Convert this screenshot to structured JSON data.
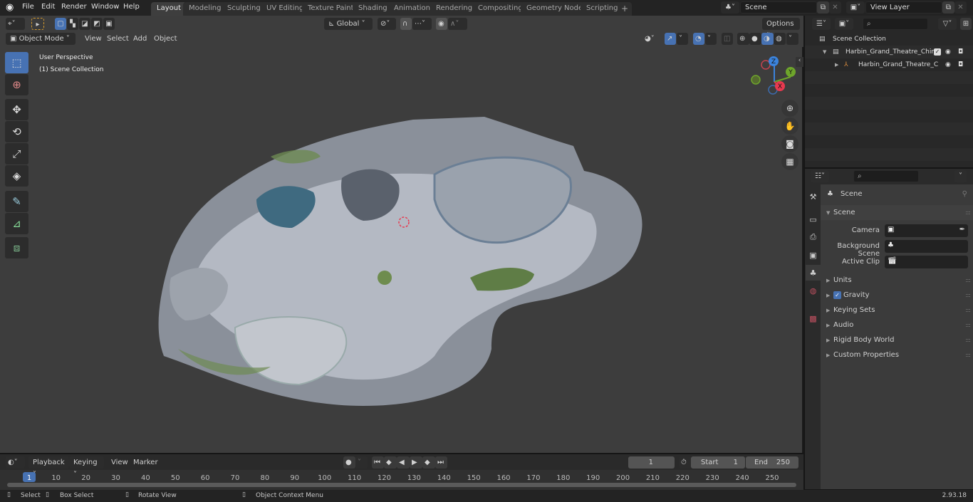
{
  "topbar": {
    "menus": [
      "File",
      "Edit",
      "Render",
      "Window",
      "Help"
    ],
    "workspaces": [
      "Layout",
      "Modeling",
      "Sculpting",
      "UV Editing",
      "Texture Paint",
      "Shading",
      "Animation",
      "Rendering",
      "Compositing",
      "Geometry Nodes",
      "Scripting"
    ],
    "active_workspace": "Layout",
    "add_workspace": "+",
    "scene_name": "Scene",
    "view_layer_name": "View Layer"
  },
  "viewport": {
    "mode": "Object Mode",
    "menus": [
      "View",
      "Select",
      "Add",
      "Object"
    ],
    "transform_orientation": "Global",
    "options_label": "Options",
    "overlay_title": "User Perspective",
    "overlay_subtitle": "(1) Scene Collection",
    "gizmo_axes": {
      "x": "X",
      "y": "Y",
      "z": "Z"
    },
    "axis_colors": {
      "x": "#e8394f",
      "y": "#6ea52b",
      "z": "#3b83dc"
    },
    "tools": [
      "select-box-icon",
      "cursor-icon",
      "move-icon",
      "rotate-icon",
      "scale-icon",
      "transform-icon",
      "annotate-icon",
      "measure-icon",
      "add-cube-icon"
    ],
    "nav_buttons": [
      "zoom-icon",
      "hand-pan-icon",
      "camera-icon",
      "grid-ortho-icon"
    ]
  },
  "outliner": {
    "root": "Scene Collection",
    "items": [
      {
        "name": "Harbin_Grand_Theatre_China",
        "type": "collection",
        "checked": true
      },
      {
        "name": "Harbin_Grand_Theatre_C",
        "type": "empty"
      }
    ]
  },
  "properties": {
    "context": "Scene",
    "section": "Scene",
    "fields": [
      {
        "label": "Camera",
        "value": ""
      },
      {
        "label": "Background Scene",
        "value": ""
      },
      {
        "label": "Active Clip",
        "value": ""
      }
    ],
    "panels": [
      "Units",
      "Gravity",
      "Keying Sets",
      "Audio",
      "Rigid Body World",
      "Custom Properties"
    ],
    "gravity_checked": true
  },
  "timeline": {
    "menus": [
      "Playback",
      "Keying",
      "View",
      "Marker"
    ],
    "current_frame": "1",
    "start_label": "Start",
    "start_value": "1",
    "end_label": "End",
    "end_value": "250",
    "ticks": [
      "1",
      "10",
      "20",
      "30",
      "40",
      "50",
      "60",
      "70",
      "80",
      "90",
      "100",
      "110",
      "120",
      "130",
      "140",
      "150",
      "160",
      "170",
      "180",
      "190",
      "200",
      "210",
      "220",
      "230",
      "240",
      "250"
    ]
  },
  "statusbar": {
    "select": "Select",
    "box_select": "Box Select",
    "rotate_view": "Rotate View",
    "context_menu": "Object Context Menu",
    "version": "2.93.18"
  }
}
